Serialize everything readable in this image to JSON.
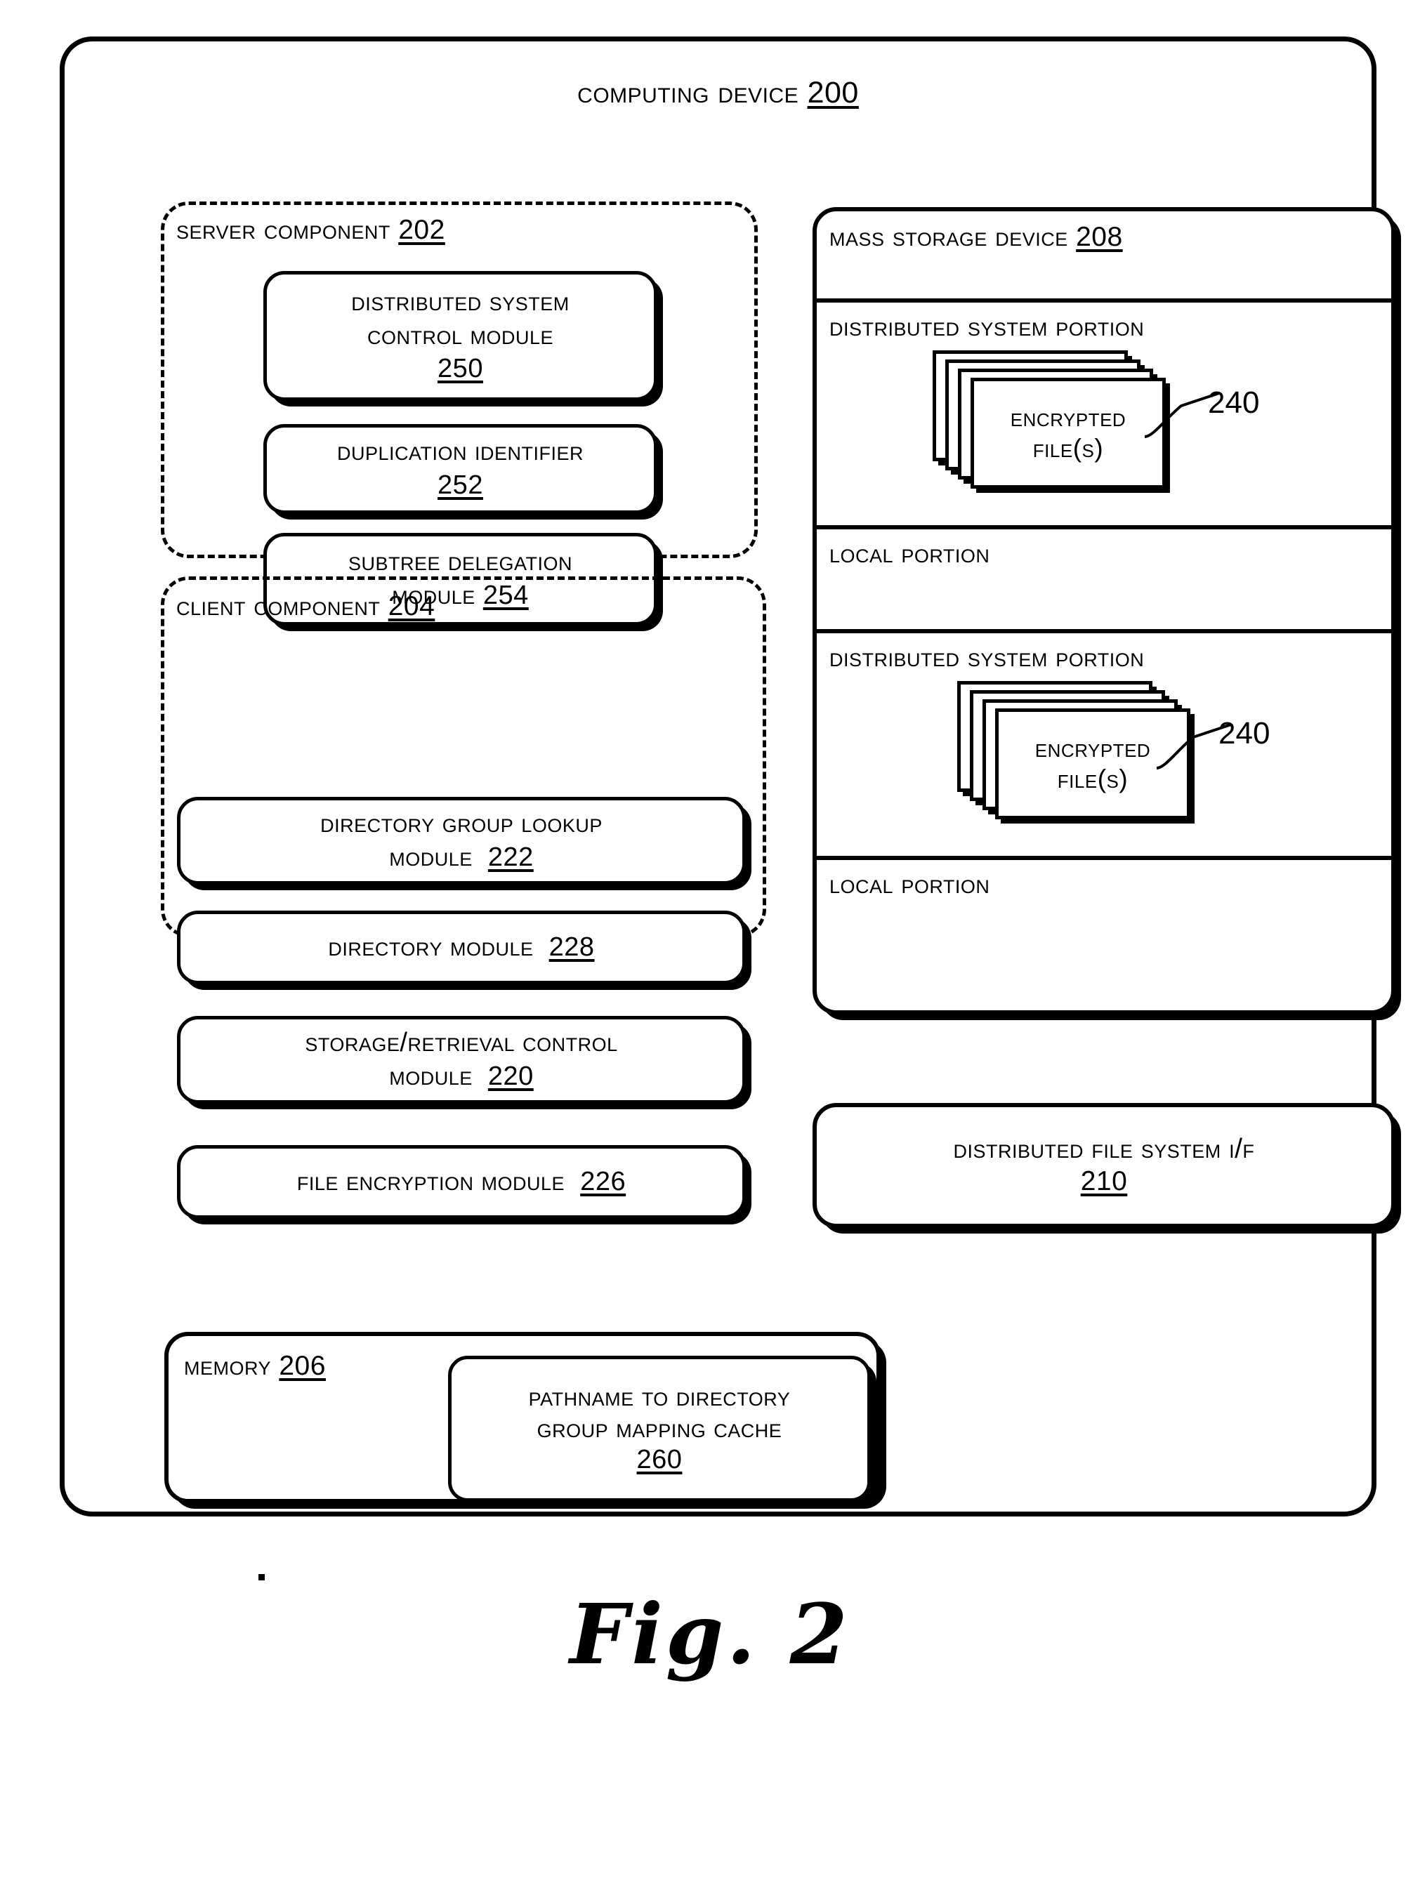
{
  "figure": {
    "caption": "Fig. 2"
  },
  "computing_device": {
    "title": "Computing Device 200",
    "title_text": "Computing Device",
    "ref": "200"
  },
  "server_component": {
    "title_text": "Server Component",
    "ref": "202",
    "modules": [
      {
        "line1": "Distributed System",
        "line2": "Control Module",
        "ref": "250",
        "ref_inline": false
      },
      {
        "line1": "Duplication Identifier",
        "line2": "",
        "ref": "252",
        "ref_inline": false
      },
      {
        "line1": "Subtree Delegation",
        "line2": "Module",
        "ref": "254",
        "ref_inline": true
      }
    ]
  },
  "client_component": {
    "title_text": "Client Component",
    "ref": "204",
    "modules": [
      {
        "line1": "Directory Group Lookup",
        "line2": "Module",
        "ref": "222",
        "ref_inline": true
      },
      {
        "line1": "Directory Module",
        "line2": "",
        "ref": "228",
        "ref_inline": true
      },
      {
        "line1": "Storage/Retrieval Control",
        "line2": "Module",
        "ref": "220",
        "ref_inline": true
      },
      {
        "line1": "File Encryption Module",
        "line2": "",
        "ref": "226",
        "ref_inline": true
      }
    ]
  },
  "mass_storage_device": {
    "title_text": "Mass Storage Device",
    "ref": "208",
    "rows": [
      {
        "label": "Distributed System Portion",
        "has_files": true
      },
      {
        "label": "Local Portion",
        "has_files": false
      },
      {
        "label": "Distributed System Portion",
        "has_files": true
      },
      {
        "label": "Local Portion",
        "has_files": false
      }
    ],
    "encrypted_files": {
      "line1": "Encrypted",
      "line2": "File(s)",
      "callout_ref": "240",
      "sheet_count": 4
    }
  },
  "distributed_file_system_if": {
    "line1": "Distributed File System I/F",
    "ref": "210"
  },
  "memory": {
    "title_text": "Memory",
    "ref": "206",
    "cache": {
      "line1": "Pathname to Directory",
      "line2": "Group Mapping Cache",
      "ref": "260"
    }
  },
  "style": {
    "ink": "#000000",
    "paper": "#ffffff"
  }
}
